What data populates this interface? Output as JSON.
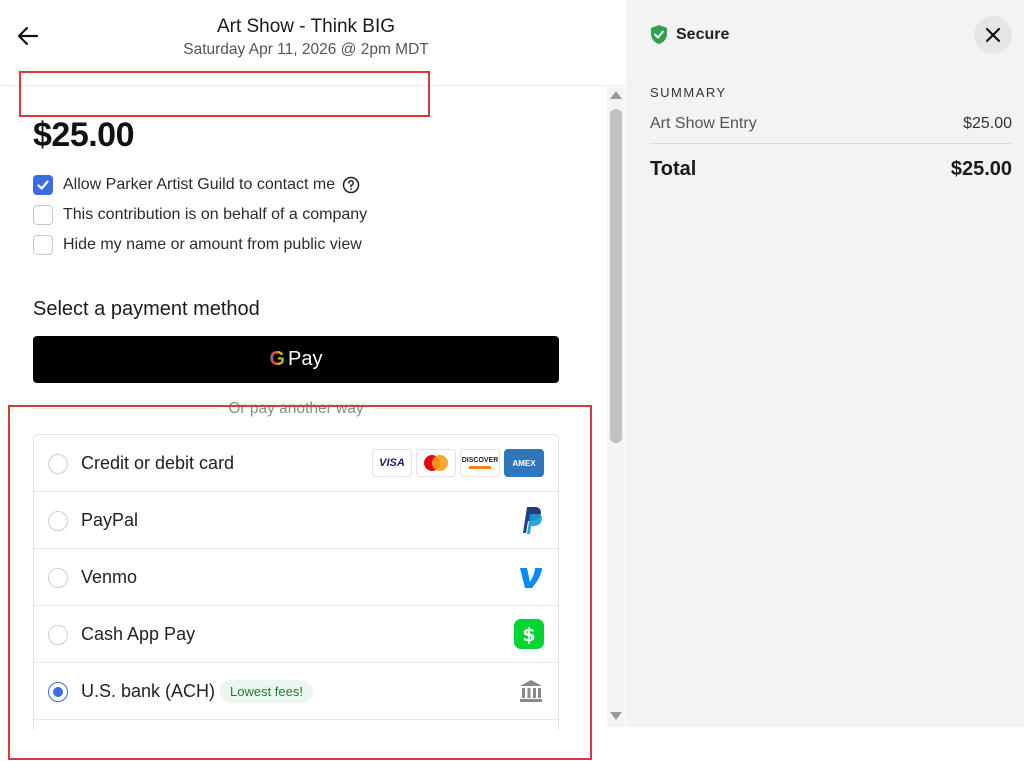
{
  "header": {
    "title": "Art Show - Think BIG",
    "date": "Saturday Apr 11, 2026 @ 2pm MDT"
  },
  "amount": "$25.00",
  "options": [
    {
      "label": "Allow Parker Artist Guild to contact me",
      "checked": true
    },
    {
      "label": "This contribution is on behalf of a company",
      "checked": false
    },
    {
      "label": "Hide my name or amount from public view",
      "checked": false
    }
  ],
  "payment": {
    "heading": "Select a payment method",
    "gpay_label": "Pay",
    "gpay_g": "G",
    "divider": "Or pay another way",
    "card_logos": {
      "visa": "VISA",
      "discover": "DISCOVER",
      "amex": "AMEX"
    },
    "badge": "Lowest fees!",
    "methods": [
      {
        "label": "Credit or debit card",
        "selected": false,
        "icon": "card-logos"
      },
      {
        "label": "PayPal",
        "selected": false,
        "icon": "paypal-icon"
      },
      {
        "label": "Venmo",
        "selected": false,
        "icon": "venmo-icon"
      },
      {
        "label": "Cash App Pay",
        "selected": false,
        "icon": "cash-app-icon"
      },
      {
        "label": "U.S. bank (ACH)",
        "selected": true,
        "icon": "bank-icon"
      }
    ]
  },
  "summary": {
    "secure": "Secure",
    "heading": "SUMMARY",
    "item_name": "Art Show Entry",
    "item_price": "$25.00",
    "total_label": "Total",
    "total_value": "$25.00"
  },
  "colors": {
    "accent": "#3d6be0",
    "highlight": "#d63a3a",
    "secure_green": "#2ea24f",
    "badge_bg": "#eaf6ee",
    "badge_text": "#217a3c"
  }
}
